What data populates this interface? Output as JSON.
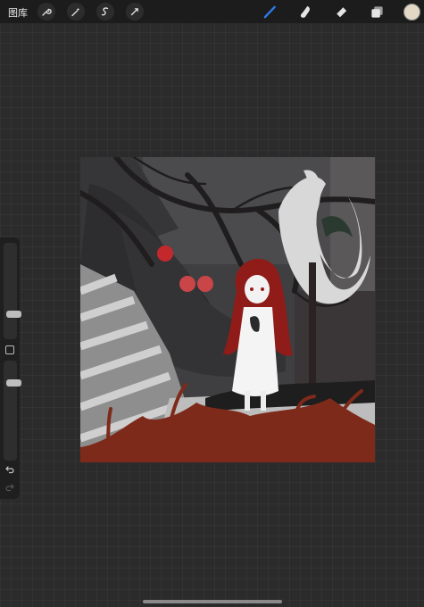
{
  "toolbar": {
    "gallery_label": "图库",
    "left_tools": [
      "wrench-icon",
      "magic-wand-icon",
      "selection-icon",
      "transform-arrow-icon"
    ],
    "right_tools": [
      "brush-icon",
      "smudge-icon",
      "eraser-icon",
      "layers-icon"
    ],
    "active_tool": "brush-icon",
    "active_color": "#e4d8c4",
    "accent_color": "#2f7bf2"
  },
  "sidebar": {
    "brush_size_level": 0.24,
    "opacity_level": 0.8
  }
}
